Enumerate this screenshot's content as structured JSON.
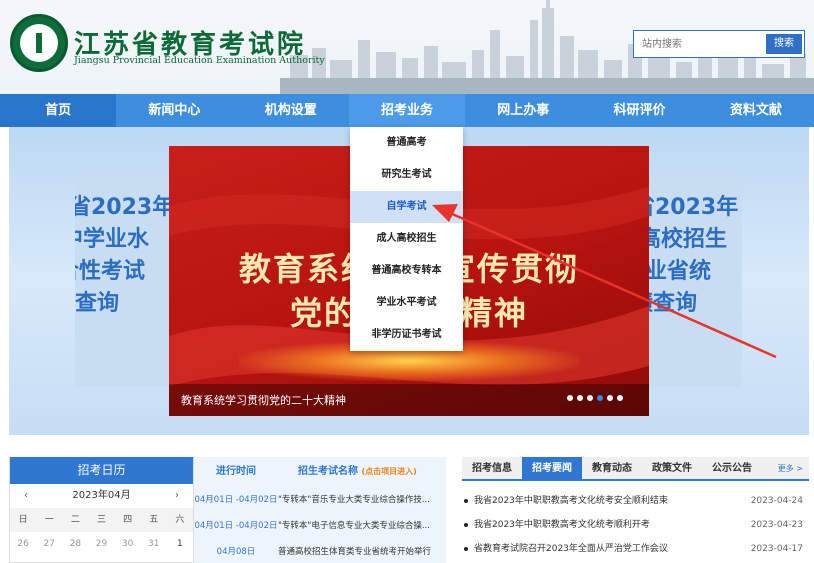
{
  "header": {
    "title_cn": "江苏省教育考试院",
    "title_en": "Jiangsu Provincial Education Examination Authority",
    "logo_icon": "seal-logo-icon",
    "search": {
      "placeholder": "站内搜索",
      "button": "搜索"
    }
  },
  "nav": {
    "items": [
      {
        "label": "首页"
      },
      {
        "label": "新闻中心"
      },
      {
        "label": "机构设置"
      },
      {
        "label": "招考业务"
      },
      {
        "label": "网上办事"
      },
      {
        "label": "科研评价"
      },
      {
        "label": "资料文献"
      }
    ],
    "active_index": 0,
    "open_index": 3
  },
  "dropdown": {
    "items": [
      {
        "label": "普通高考"
      },
      {
        "label": "研究生考试"
      },
      {
        "label": "自学考试"
      },
      {
        "label": "成人高校招生"
      },
      {
        "label": "普通高校专转本"
      },
      {
        "label": "学业水平考试"
      },
      {
        "label": "非学历证书考试"
      }
    ],
    "highlighted_index": 2
  },
  "banner": {
    "left_card_lines": [
      "省2023年",
      "中学业水",
      "合性考试",
      "绩查询"
    ],
    "right_card_lines": [
      "省2023年",
      "高校招生",
      "学业省统",
      "绩查询"
    ],
    "headline_line1": "教育系统学习宣传贯彻",
    "headline_line2": "党的二十大精神",
    "caption": "教育系统学习贯彻党的二十大精神",
    "dot_count": 6,
    "active_dot": 3
  },
  "calendar": {
    "title": "招考日历",
    "month": "2023年04月",
    "prev_icon": "‹",
    "next_icon": "›",
    "weekdays": [
      "日",
      "一",
      "二",
      "三",
      "四",
      "五",
      "六"
    ],
    "days": [
      {
        "d": "26",
        "cur": false
      },
      {
        "d": "27",
        "cur": false
      },
      {
        "d": "28",
        "cur": false
      },
      {
        "d": "29",
        "cur": false
      },
      {
        "d": "30",
        "cur": false
      },
      {
        "d": "31",
        "cur": false
      },
      {
        "d": "1",
        "cur": true
      }
    ]
  },
  "exams": {
    "col_time": "进行时间",
    "col_name": "招生考试名称",
    "col_name_note": "(点击项目进入)",
    "rows": [
      {
        "date": "04月01日 -04月02日",
        "name": "\"专转本\"音乐专业大类专业综合操作技..."
      },
      {
        "date": "04月01日 -04月02日",
        "name": "\"专转本\"电子信息专业大类专业综合操..."
      },
      {
        "date": "04月08日",
        "name": "普通高校招生体育类专业省统考开始举行"
      }
    ]
  },
  "news": {
    "tabs": [
      {
        "label": "招考信息"
      },
      {
        "label": "招考要闻"
      },
      {
        "label": "教育动态"
      },
      {
        "label": "政策文件"
      },
      {
        "label": "公示公告"
      }
    ],
    "active_tab": 1,
    "more": "更多 >",
    "items": [
      {
        "title": "我省2023年中职职教高考文化统考安全顺利结束",
        "date": "2023-04-24"
      },
      {
        "title": "我省2023年中职职教高考文化统考顺利开考",
        "date": "2023-04-23"
      },
      {
        "title": "省教育考试院召开2023年全面从严治党工作会议",
        "date": "2023-04-17"
      }
    ]
  },
  "colors": {
    "nav_blue": "#3e8ee0",
    "brand_green": "#0b6a36",
    "banner_red": "#c81f1a",
    "annotation_arrow": "#e8332a"
  }
}
